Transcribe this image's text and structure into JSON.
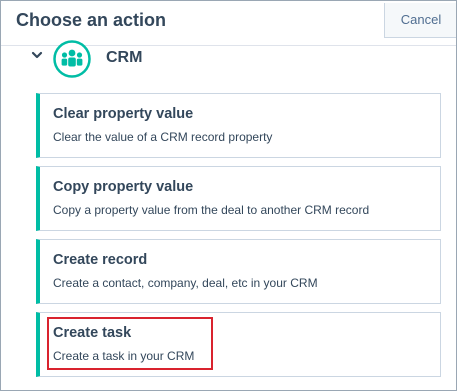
{
  "header": {
    "title": "Choose an action",
    "cancel_label": "Cancel"
  },
  "group": {
    "label": "CRM",
    "expanded": true,
    "icon": "crm-people-icon",
    "accent": "#00bda5"
  },
  "actions": [
    {
      "title": "Clear property value",
      "description": "Clear the value of a CRM record property"
    },
    {
      "title": "Copy property value",
      "description": "Copy a property value from the deal to another CRM record"
    },
    {
      "title": "Create record",
      "description": "Create a contact, company, deal, etc in your CRM"
    },
    {
      "title": "Create task",
      "description": "Create a task in your CRM",
      "highlighted": true
    }
  ],
  "colors": {
    "text": "#33475b",
    "highlight": "#d9232e",
    "card_accent": "#00bda5"
  }
}
